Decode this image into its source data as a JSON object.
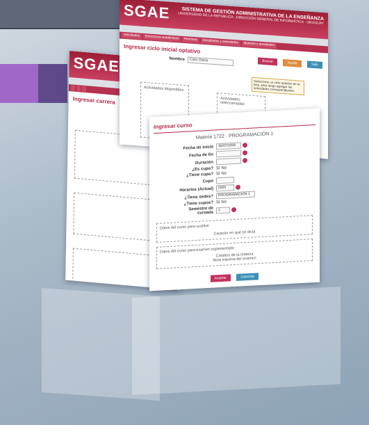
{
  "logo": "SGAE",
  "system_title": "SISTEMA DE GESTIÓN ADMINISTRATIVA DE LA ENSEÑANZA",
  "system_subtitle": "UNIVERSIDAD DE LA REPÚBLICA · DIRECCIÓN GENERAL DE INFORMÁTICA · URUGUAY",
  "back_shot": {
    "page_title": "Ingresar carrera"
  },
  "mid_shot": {
    "page_title": "Ingresar ciclo inicial optativo",
    "menu": [
      "Actividades",
      "Estructuras académicas",
      "Permisos",
      "Estudiantes y actividades",
      "Materias y actividades",
      "Mantenimiento"
    ],
    "tabs": [
      "Nombre",
      "Nodos"
    ],
    "buttons": [
      "Buscar",
      "Ayuda",
      "Salir"
    ],
    "name_label": "Nombre",
    "name_value": "Ciclo Chiclo",
    "list_left_title": "Actividades disponibles",
    "list_right_title": "Actividades seleccionadas",
    "tooltip": "Seleccione un ciclo optativo de la lista, para luego agregar las actividades correspondientes."
  },
  "front_shot": {
    "page_title": "Ingresar curso",
    "form_title": "Materia 1722 - PROGRAMACIÓN 1",
    "fields": [
      {
        "label": "Fecha de inicio",
        "value": "30/07/2009"
      },
      {
        "label": "Fecha de fin",
        "value": ""
      },
      {
        "label": "Duración",
        "value": ""
      },
      {
        "label": "¿Es cupo?",
        "value": "Sí   No"
      },
      {
        "label": "¿Tiene cupo?",
        "value": "Sí   No"
      },
      {
        "label": "Cupo",
        "value": ""
      },
      {
        "label": "Horarios (Actual)",
        "value": "2009"
      },
      {
        "label": "¿Tiene sedes?",
        "value": "PROGRAMACIÓN 1"
      },
      {
        "label": "¿Tiene cupos?",
        "value": "Sí   No"
      },
      {
        "label": "Semestre de cursada",
        "value": "1"
      }
    ],
    "box1_title": "Datos del curso para sustituir",
    "box1_line": "Carácter en que se dicta",
    "box2_title": "Datos del curso para examen reglamentado",
    "box2_lines": [
      "Créditos de la materia",
      "Nota máxima del examen"
    ],
    "submit_buttons": [
      "Aceptar",
      "Cancelar"
    ]
  },
  "colors": {
    "accent": "#b4294a",
    "purple_a": "#a067c9",
    "purple_b": "#5e4a8a"
  }
}
